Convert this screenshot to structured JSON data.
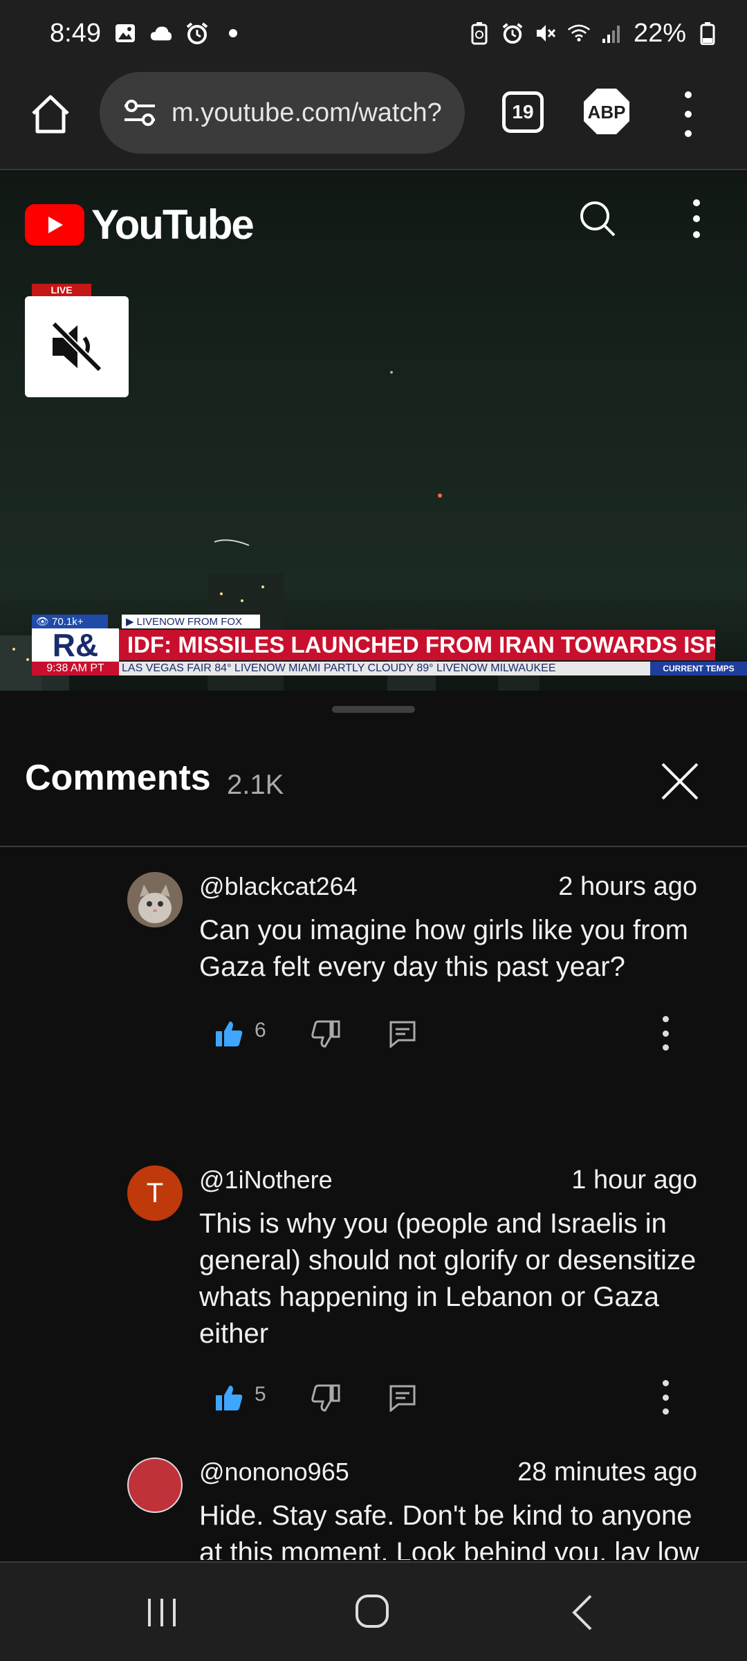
{
  "status_bar": {
    "time": "8:49",
    "battery": "22%",
    "left_icons": [
      "gallery-icon",
      "cloud-icon",
      "alarm-icon",
      "dot-icon"
    ],
    "right_icons": [
      "battery-saver-icon",
      "alarm-icon",
      "mute-icon",
      "wifi-icon",
      "signal-icon",
      "battery-icon"
    ]
  },
  "browser": {
    "url": "m.youtube.com/watch?",
    "tab_count": "19",
    "adblock_label": "ABP"
  },
  "youtube": {
    "logo_text": "YouTube",
    "brand_color": "#ff0000"
  },
  "video": {
    "live_label": "LIVE",
    "overlay": {
      "views": "70.1k+",
      "source": "LIVENOW FROM FOX",
      "network": "R&",
      "headline": "IDF: MISSILES LAUNCHED FROM IRAN TOWARDS ISRAEL",
      "clock": "9:38 AM PT",
      "weather": "LAS VEGAS   FAIR 84°   LIVENOW   MIAMI   PARTLY CLOUDY 89°   LIVENOW   MILWAUKEE",
      "temps_label": "CURRENT TEMPS"
    }
  },
  "comments": {
    "title": "Comments",
    "count": "2.1K",
    "items": [
      {
        "handle": "@blackcat264",
        "time": "2 hours ago",
        "text": "Can you imagine how girls like you from Gaza felt every day this past year?",
        "likes": "6",
        "avatar_letter": ""
      },
      {
        "handle": "@1iNothere",
        "time": "1 hour ago",
        "text": "This is why you (people and Israelis in general) should not glorify or desensitize whats happening in Lebanon or Gaza either",
        "likes": "5",
        "avatar_letter": "T"
      },
      {
        "handle": "@nonono965",
        "time": "28 minutes ago",
        "text": "Hide.  Stay safe.  Don't be kind to anyone at this moment.  Look behind you, lay low and let us know how you are.",
        "likes": "",
        "avatar_letter": ""
      }
    ]
  },
  "colors": {
    "like_blue": "#3ea6ff",
    "avatar_orange": "#c0390b",
    "avatar_red": "#c0323a"
  }
}
